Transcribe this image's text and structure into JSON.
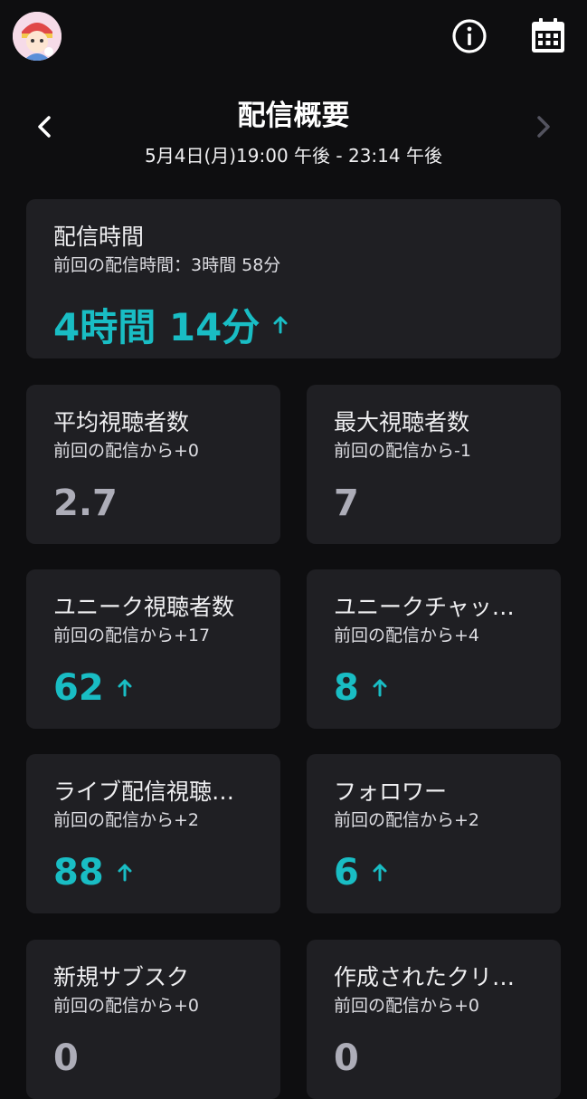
{
  "header": {
    "title": "配信概要",
    "date_range": "5月4日(月)19:00 午後 - 23:14 午後"
  },
  "stream_time": {
    "title": "配信時間",
    "sub": "前回の配信時間：3時間 58分",
    "value": "4時間 14分",
    "trend": "up"
  },
  "stats": [
    {
      "title": "平均視聴者数",
      "sub": "前回の配信から+0",
      "value": "2.7",
      "trend": "none"
    },
    {
      "title": "最大視聴者数",
      "sub": "前回の配信から-1",
      "value": "7",
      "trend": "none"
    },
    {
      "title": "ユニーク視聴者数",
      "sub": "前回の配信から+17",
      "value": "62",
      "trend": "up"
    },
    {
      "title": "ユニークチャッ…",
      "sub": "前回の配信から+4",
      "value": "8",
      "trend": "up"
    },
    {
      "title": "ライブ配信視聴…",
      "sub": "前回の配信から+2",
      "value": "88",
      "trend": "up"
    },
    {
      "title": "フォロワー",
      "sub": "前回の配信から+2",
      "value": "6",
      "trend": "up"
    },
    {
      "title": "新規サブスク",
      "sub": "前回の配信から+0",
      "value": "0",
      "trend": "none"
    },
    {
      "title": "作成されたクリ…",
      "sub": "前回の配信から+0",
      "value": "0",
      "trend": "none"
    }
  ],
  "icons": {
    "avatar": "avatar-image",
    "info": "info-icon",
    "calendar": "calendar-icon",
    "prev": "chevron-left-icon",
    "next": "chevron-right-icon",
    "trend_up": "arrow-up-icon"
  },
  "colors": {
    "background": "#0e0e10",
    "card": "#1f1f23",
    "trend_up": "#19bdc4",
    "neutral_value": "#adadb8"
  }
}
